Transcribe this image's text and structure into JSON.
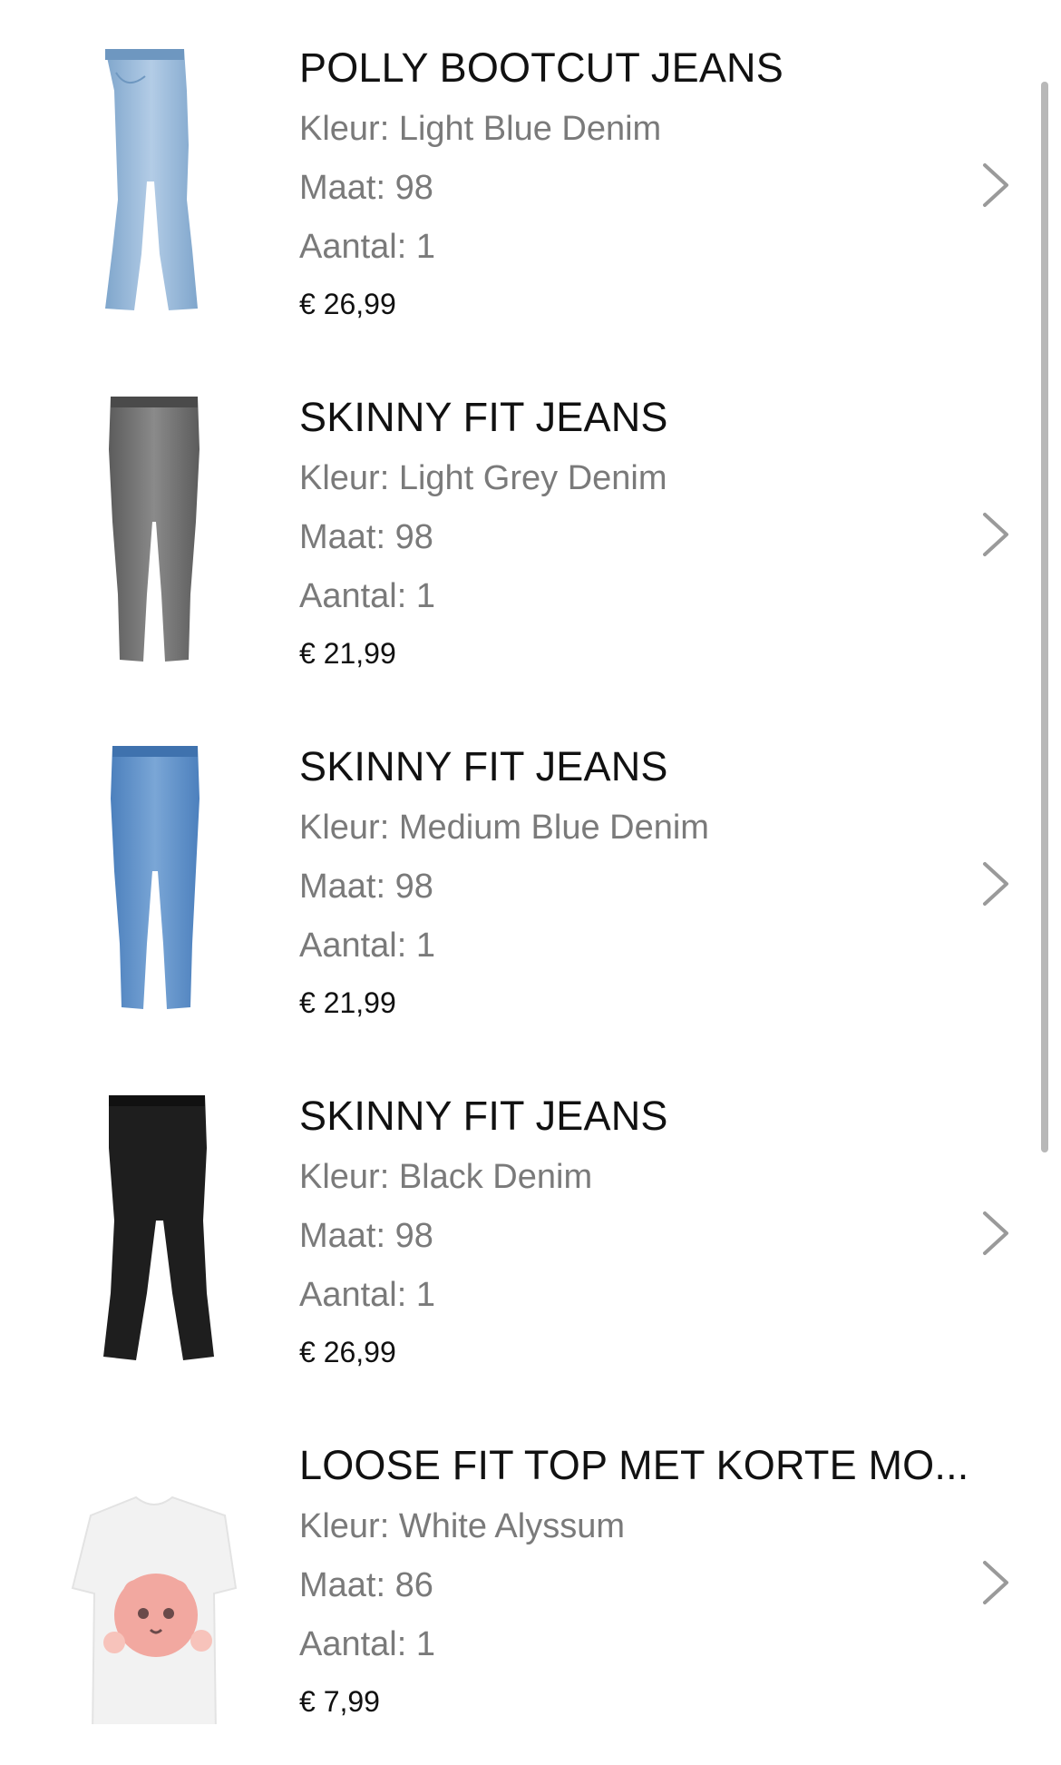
{
  "items": [
    {
      "title": "POLLY BOOTCUT JEANS",
      "color": "Kleur: Light Blue Denim",
      "size": "Maat: 98",
      "quantity": "Aantal: 1",
      "price": "€ 26,99",
      "image_icon": "jeans-light-blue-bootcut-icon"
    },
    {
      "title": "SKINNY FIT JEANS",
      "color": "Kleur: Light Grey Denim",
      "size": "Maat: 98",
      "quantity": "Aantal: 1",
      "price": "€ 21,99",
      "image_icon": "jeans-light-grey-skinny-icon"
    },
    {
      "title": "SKINNY FIT JEANS",
      "color": "Kleur: Medium Blue Denim",
      "size": "Maat: 98",
      "quantity": "Aantal: 1",
      "price": "€ 21,99",
      "image_icon": "jeans-medium-blue-skinny-icon"
    },
    {
      "title": "SKINNY FIT JEANS",
      "color": "Kleur: Black Denim",
      "size": "Maat: 98",
      "quantity": "Aantal: 1",
      "price": "€ 26,99",
      "image_icon": "jeans-black-flared-icon"
    },
    {
      "title": "LOOSE FIT TOP MET KORTE MO...",
      "color": "Kleur: White Alyssum",
      "size": "Maat: 86",
      "quantity": "Aantal: 1",
      "price": "€ 7,99",
      "image_icon": "tshirt-white-leopard-icon"
    }
  ],
  "colors": {
    "title": "#111111",
    "secondary_text": "#7a7a7a",
    "chevron": "#9a9a9a",
    "scrollbar": "#b8b8b8"
  }
}
